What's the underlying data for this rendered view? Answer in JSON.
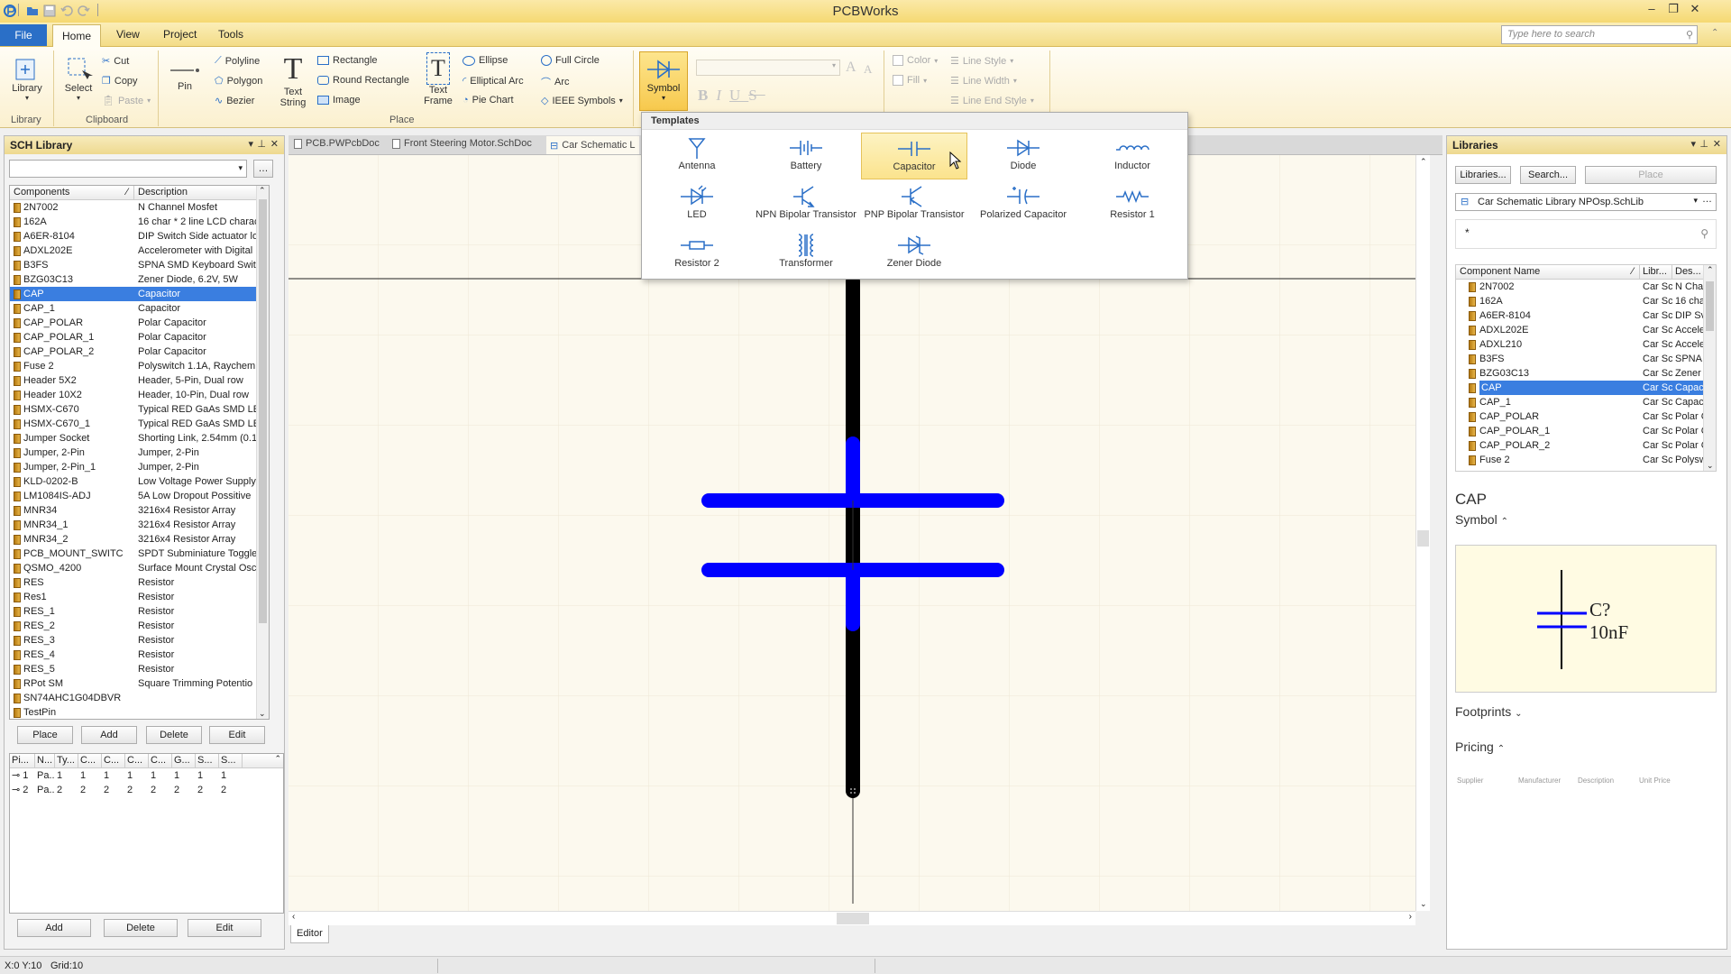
{
  "app": {
    "title": "PCBWorks"
  },
  "search": {
    "placeholder": "Type here to search"
  },
  "menu": {
    "file": "File",
    "tabs": [
      "Home",
      "View",
      "Project",
      "Tools"
    ]
  },
  "ribbon": {
    "library": "Library",
    "select": "Select",
    "cut": "Cut",
    "copy": "Copy",
    "paste": "Paste",
    "pin": "Pin",
    "polyline": "Polyline",
    "polygon": "Polygon",
    "bezier": "Bezier",
    "text_string": "Text String",
    "rectangle": "Rectangle",
    "round_rectangle": "Round Rectangle",
    "image": "Image",
    "text_frame": "Text Frame",
    "ellipse": "Ellipse",
    "elliptical_arc": "Elliptical Arc",
    "pie_chart": "Pie Chart",
    "full_circle": "Full Circle",
    "arc": "Arc",
    "ieee_symbols": "IEEE Symbols",
    "symbol": "Symbol",
    "color": "Color",
    "fill": "Fill",
    "line_style": "Line Style",
    "line_width": "Line Width",
    "line_end_style": "Line End Style",
    "groups": {
      "library": "Library",
      "clipboard": "Clipboard",
      "place": "Place"
    }
  },
  "templates": {
    "header": "Templates",
    "items": [
      "Antenna",
      "Battery",
      "Capacitor",
      "Diode",
      "Inductor",
      "LED",
      "NPN Bipolar Transistor",
      "PNP Bipolar Transistor",
      "Polarized Capacitor",
      "Resistor 1",
      "Resistor 2",
      "Transformer",
      "Zener Diode"
    ],
    "highlighted": "Capacitor"
  },
  "sch_library": {
    "title": "SCH Library",
    "col_components": "Components",
    "col_description": "Description",
    "rows": [
      [
        "2N7002",
        "N Channel Mosfet"
      ],
      [
        "162A",
        "16 char * 2 line LCD charac"
      ],
      [
        "A6ER-8104",
        "DIP Switch Side actuator lo"
      ],
      [
        "ADXL202E",
        "Accelerometer with Digital"
      ],
      [
        "B3FS",
        "SPNA SMD Keyboard Switc"
      ],
      [
        "BZG03C13",
        "Zener Diode, 6.2V, 5W"
      ],
      [
        "CAP",
        "Capacitor"
      ],
      [
        "CAP_1",
        "Capacitor"
      ],
      [
        "CAP_POLAR",
        "Polar Capacitor"
      ],
      [
        "CAP_POLAR_1",
        "Polar Capacitor"
      ],
      [
        "CAP_POLAR_2",
        "Polar Capacitor"
      ],
      [
        "Fuse 2",
        "Polyswitch 1.1A, Raychem"
      ],
      [
        "Header 5X2",
        "Header, 5-Pin, Dual row"
      ],
      [
        "Header 10X2",
        "Header, 10-Pin, Dual row"
      ],
      [
        "HSMX-C670",
        "Typical RED GaAs SMD LED"
      ],
      [
        "HSMX-C670_1",
        "Typical RED GaAs SMD LED"
      ],
      [
        "Jumper Socket",
        "Shorting Link, 2.54mm (0.1"
      ],
      [
        "Jumper, 2-Pin",
        "Jumper, 2-Pin"
      ],
      [
        "Jumper, 2-Pin_1",
        "Jumper, 2-Pin"
      ],
      [
        "KLD-0202-B",
        "Low Voltage Power Supply"
      ],
      [
        "LM1084IS-ADJ",
        "5A Low Dropout Possitive"
      ],
      [
        "MNR34",
        "3216x4 Resistor Array"
      ],
      [
        "MNR34_1",
        "3216x4 Resistor Array"
      ],
      [
        "MNR34_2",
        "3216x4 Resistor Array"
      ],
      [
        "PCB_MOUNT_SWITC",
        "SPDT Subminiature Toggle"
      ],
      [
        "QSMO_4200",
        "Surface Mount Crystal Osc"
      ],
      [
        "RES",
        "Resistor"
      ],
      [
        "Res1",
        "Resistor"
      ],
      [
        "RES_1",
        "Resistor"
      ],
      [
        "RES_2",
        "Resistor"
      ],
      [
        "RES_3",
        "Resistor"
      ],
      [
        "RES_4",
        "Resistor"
      ],
      [
        "RES_5",
        "Resistor"
      ],
      [
        "RPot SM",
        "Square Trimming Potentio"
      ],
      [
        "SN74AHC1G04DBVR",
        ""
      ],
      [
        "TestPin",
        ""
      ]
    ],
    "selected": "CAP",
    "buttons": {
      "place": "Place",
      "add": "Add",
      "delete": "Delete",
      "edit": "Edit"
    },
    "pin_headers": [
      "Pi...",
      "N...",
      "Ty...",
      "C...",
      "C...",
      "C...",
      "C...",
      "G...",
      "S...",
      "S..."
    ],
    "pin_rows": [
      [
        "1",
        "Pa...",
        "1",
        "1",
        "1",
        "1",
        "1",
        "1",
        "1",
        "1"
      ],
      [
        "2",
        "Pa...",
        "2",
        "2",
        "2",
        "2",
        "2",
        "2",
        "2",
        "2"
      ]
    ],
    "pin_buttons": {
      "add": "Add",
      "delete": "Delete",
      "edit": "Edit"
    }
  },
  "doc_tabs": [
    "PCB.PWPcbDoc",
    "Front Steering Motor.SchDoc",
    "Car Schematic L"
  ],
  "editor_tab": "Editor",
  "libraries": {
    "title": "Libraries",
    "btn_libraries": "Libraries...",
    "btn_search": "Search...",
    "btn_place": "Place",
    "library_select": "Car Schematic Library NPOsp.SchLib",
    "filter": "*",
    "col_name": "Component Name",
    "col_lib": "Libr...",
    "col_desc": "Des...",
    "rows": [
      [
        "2N7002",
        "Car Sc",
        "N Cha"
      ],
      [
        "162A",
        "Car Sc",
        "16 cha"
      ],
      [
        "A6ER-8104",
        "Car Sc",
        "DIP Sv"
      ],
      [
        "ADXL202E",
        "Car Sc",
        "Accele"
      ],
      [
        "ADXL210",
        "Car Sc",
        "Accele"
      ],
      [
        "B3FS",
        "Car Sc",
        "SPNA S"
      ],
      [
        "BZG03C13",
        "Car Sc",
        "Zener"
      ],
      [
        "CAP",
        "Car Sc",
        "Capac"
      ],
      [
        "CAP_1",
        "Car Sc",
        "Capac"
      ],
      [
        "CAP_POLAR",
        "Car Sc",
        "Polar C"
      ],
      [
        "CAP_POLAR_1",
        "Car Sc",
        "Polar C"
      ],
      [
        "CAP_POLAR_2",
        "Car Sc",
        "Polar C"
      ],
      [
        "Fuse 2",
        "Car Sc",
        "Polysw"
      ]
    ],
    "selected": "CAP",
    "component_title": "CAP",
    "symbol_label": "Symbol",
    "preview_designator": "C?",
    "preview_value": "10nF",
    "footprints_label": "Footprints",
    "pricing_label": "Pricing",
    "pricing_cols": [
      "Supplier",
      "Manufacturer",
      "Description",
      "Unit Price"
    ]
  },
  "status": {
    "coords": "X:0 Y:10",
    "grid": "Grid:10"
  },
  "colors": {
    "accent": "#3a7ee0",
    "ribbon": "#f7dd86",
    "symbol_blue": "#0000ff",
    "canvas": "#fcf9ee"
  }
}
